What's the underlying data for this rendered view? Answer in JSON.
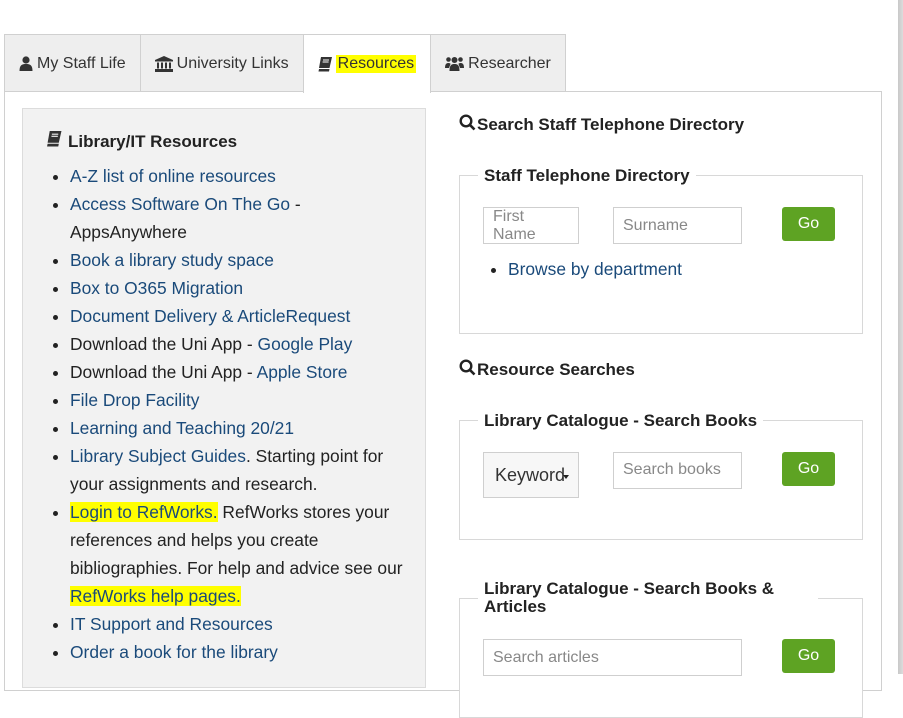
{
  "tabs": [
    {
      "label": "My Staff Life",
      "icon": "user-icon",
      "active": false
    },
    {
      "label": "University Links",
      "icon": "university-icon",
      "active": false
    },
    {
      "label": "Resources",
      "icon": "book-icon",
      "active": true,
      "highlighted": true
    },
    {
      "label": "Researcher",
      "icon": "users-icon",
      "active": false
    }
  ],
  "library": {
    "title": "Library/IT Resources",
    "icon": "book-icon",
    "items": [
      {
        "link": "A-Z list of online resources"
      },
      {
        "link": "Access Software On The Go",
        "suffix": " - AppsAnywhere"
      },
      {
        "link": "Book a library study space"
      },
      {
        "link": "Box to O365 Migration"
      },
      {
        "link": "Document Delivery & ArticleRequest"
      },
      {
        "prefix": "Download the Uni App - ",
        "link": "Google Play"
      },
      {
        "prefix": "Download the Uni App - ",
        "link": "Apple Store"
      },
      {
        "link": "File Drop Facility"
      },
      {
        "link": "Learning and Teaching 20/21"
      },
      {
        "link": "Library Subject Guides",
        "suffix": ". Starting point for your assignments and research."
      },
      {
        "link": "Login to RefWorks.",
        "link_highlighted": true,
        "suffix": " RefWorks stores your references and helps you create bibliographies. For help and advice see our ",
        "link2": "RefWorks help pages.",
        "link2_highlighted": true
      },
      {
        "link": "IT Support and Resources"
      },
      {
        "link": "Order a book for the library"
      }
    ]
  },
  "directory": {
    "heading": "Search Staff Telephone Directory",
    "legend": "Staff Telephone Directory",
    "first_name_placeholder": "First Name",
    "surname_placeholder": "Surname",
    "go_label": "Go",
    "browse_link": "Browse by department"
  },
  "resources": {
    "heading": "Resource Searches",
    "books": {
      "legend": "Library Catalogue - Search Books",
      "select_value": "Keyword",
      "placeholder": "Search books",
      "go_label": "Go"
    },
    "articles": {
      "legend_line1": "Library Catalogue - Search Books &",
      "legend_line2": "Articles",
      "placeholder": "Search articles",
      "go_label": "Go"
    }
  },
  "colors": {
    "link": "#1a4a7a",
    "go_button": "#5ea323",
    "highlight": "#ffff00",
    "tab_inactive": "#eeeeee",
    "left_box_bg": "#f2f2f2"
  }
}
